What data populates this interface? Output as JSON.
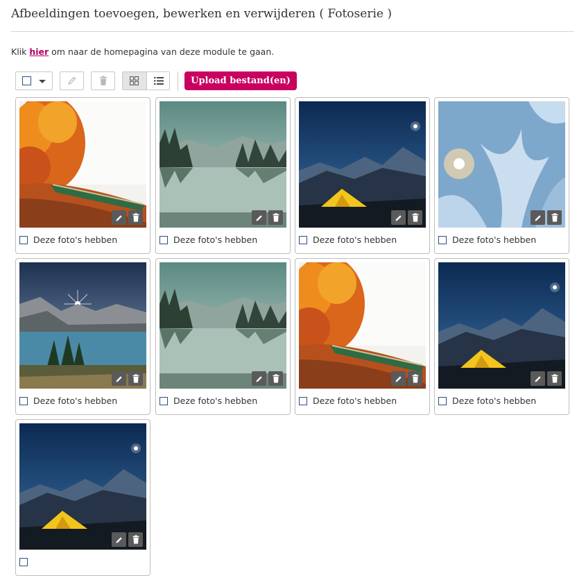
{
  "header": {
    "title": "Afbeeldingen toevoegen, bewerken en verwijderen ( Fotoserie )"
  },
  "intro": {
    "prefix": "Klik ",
    "link_text": "hier",
    "suffix": " om naar de homepagina van deze module te gaan."
  },
  "toolbar": {
    "select_icon": "checkbox-dropdown",
    "edit_icon": "pencil-icon",
    "delete_icon": "trash-icon",
    "grid_view_icon": "grid-icon",
    "list_view_icon": "list-icon",
    "active_view": "grid",
    "upload_label": "Upload bestand(en)"
  },
  "colors": {
    "accent": "#c8005f",
    "link": "#b5005f",
    "checkbox_border": "#2c4f7e",
    "card_action_bg": "#5a5a5a"
  },
  "gallery": {
    "items": [
      {
        "image": "autumn-canoe-lake",
        "label": "Deze foto's hebben"
      },
      {
        "image": "misty-forest-lake",
        "label": "Deze foto's hebben"
      },
      {
        "image": "tent-under-night-sky",
        "label": "Deze foto's hebben"
      },
      {
        "image": "ice-crystals",
        "label": "Deze foto's hebben"
      },
      {
        "image": "mountain-lake-sunburst",
        "label": "Deze foto's hebben"
      },
      {
        "image": "misty-forest-lake",
        "label": "Deze foto's hebben"
      },
      {
        "image": "autumn-canoe-lake",
        "label": "Deze foto's hebben"
      },
      {
        "image": "tent-under-night-sky",
        "label": "Deze foto's hebben"
      },
      {
        "image": "tent-under-night-sky",
        "label": ""
      }
    ]
  }
}
